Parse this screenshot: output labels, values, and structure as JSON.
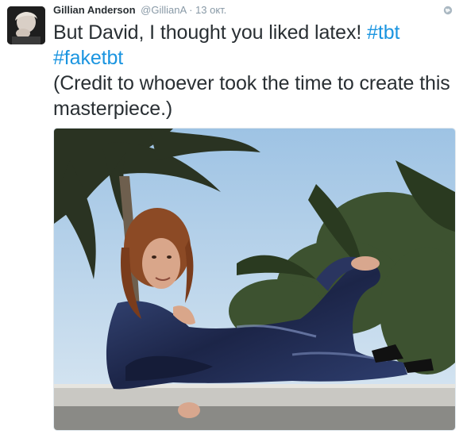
{
  "tweet": {
    "author": {
      "name": "Gillian Anderson",
      "handle": "@GillianA"
    },
    "separator": "·",
    "timestamp": "13 окт.",
    "text": {
      "line1": "But David, I thought you liked latex! ",
      "hashtag1": "#tbt",
      "hashtag2": "#faketbt",
      "line2": "(Credit to whoever took the time to create this masterpiece.)"
    },
    "icons": {
      "avatar": "profile-photo",
      "visibility": "globe-icon"
    },
    "colors": {
      "link": "#1b95e0",
      "meta": "#8899a6",
      "text": "#292f33"
    }
  }
}
